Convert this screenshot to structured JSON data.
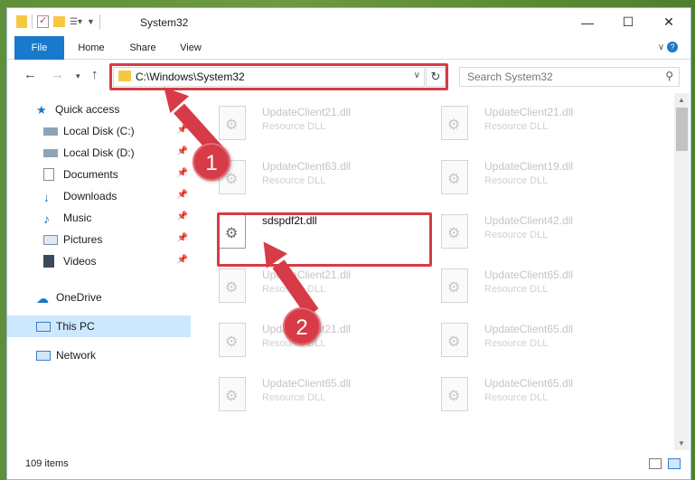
{
  "window": {
    "title": "System32"
  },
  "ribbon": {
    "tabs": [
      "File",
      "Home",
      "Share",
      "View"
    ]
  },
  "address": {
    "path": "C:\\Windows\\System32",
    "search_placeholder": "Search System32"
  },
  "nav": {
    "items": [
      {
        "label": "Quick access",
        "icon": "star-icon",
        "pinned": false
      },
      {
        "label": "Local Disk (C:)",
        "icon": "drive-icon",
        "pinned": true
      },
      {
        "label": "Local Disk (D:)",
        "icon": "drive-icon",
        "pinned": true
      },
      {
        "label": "Documents",
        "icon": "document-icon",
        "pinned": true
      },
      {
        "label": "Downloads",
        "icon": "download-icon",
        "pinned": true
      },
      {
        "label": "Music",
        "icon": "music-icon",
        "pinned": true
      },
      {
        "label": "Pictures",
        "icon": "picture-icon",
        "pinned": true
      },
      {
        "label": "Videos",
        "icon": "video-icon",
        "pinned": true
      },
      {
        "label": "OneDrive",
        "icon": "cloud-icon",
        "pinned": false
      },
      {
        "label": "This PC",
        "icon": "computer-icon",
        "pinned": false,
        "selected": true
      },
      {
        "label": "Network",
        "icon": "network-icon",
        "pinned": false
      }
    ]
  },
  "files": [
    {
      "name": "UpdateClient21.dll",
      "type": "Resource DLL"
    },
    {
      "name": "UpdateClient21.dll",
      "type": "Resource DLL"
    },
    {
      "name": "UpdateClient63.dll",
      "type": "Resource DLL"
    },
    {
      "name": "UpdateClient19.dll",
      "type": "Resource DLL"
    },
    {
      "name": "sdspdf2t.dll",
      "type": "",
      "highlighted": true
    },
    {
      "name": "UpdateClient42.dll",
      "type": "Resource DLL"
    },
    {
      "name": "UpdateClient21.dll",
      "type": "Resource DLL"
    },
    {
      "name": "UpdateClient65.dll",
      "type": "Resource DLL"
    },
    {
      "name": "UpdateClient21.dll",
      "type": "Resource DLL"
    },
    {
      "name": "UpdateClient65.dll",
      "type": "Resource DLL"
    },
    {
      "name": "UpdateClient65.dll",
      "type": "Resource DLL"
    },
    {
      "name": "UpdateClient65.dll",
      "type": "Resource DLL"
    }
  ],
  "status": {
    "item_count": "109 items"
  },
  "annotations": {
    "step1": "1",
    "step2": "2",
    "color": "#d63b47"
  }
}
